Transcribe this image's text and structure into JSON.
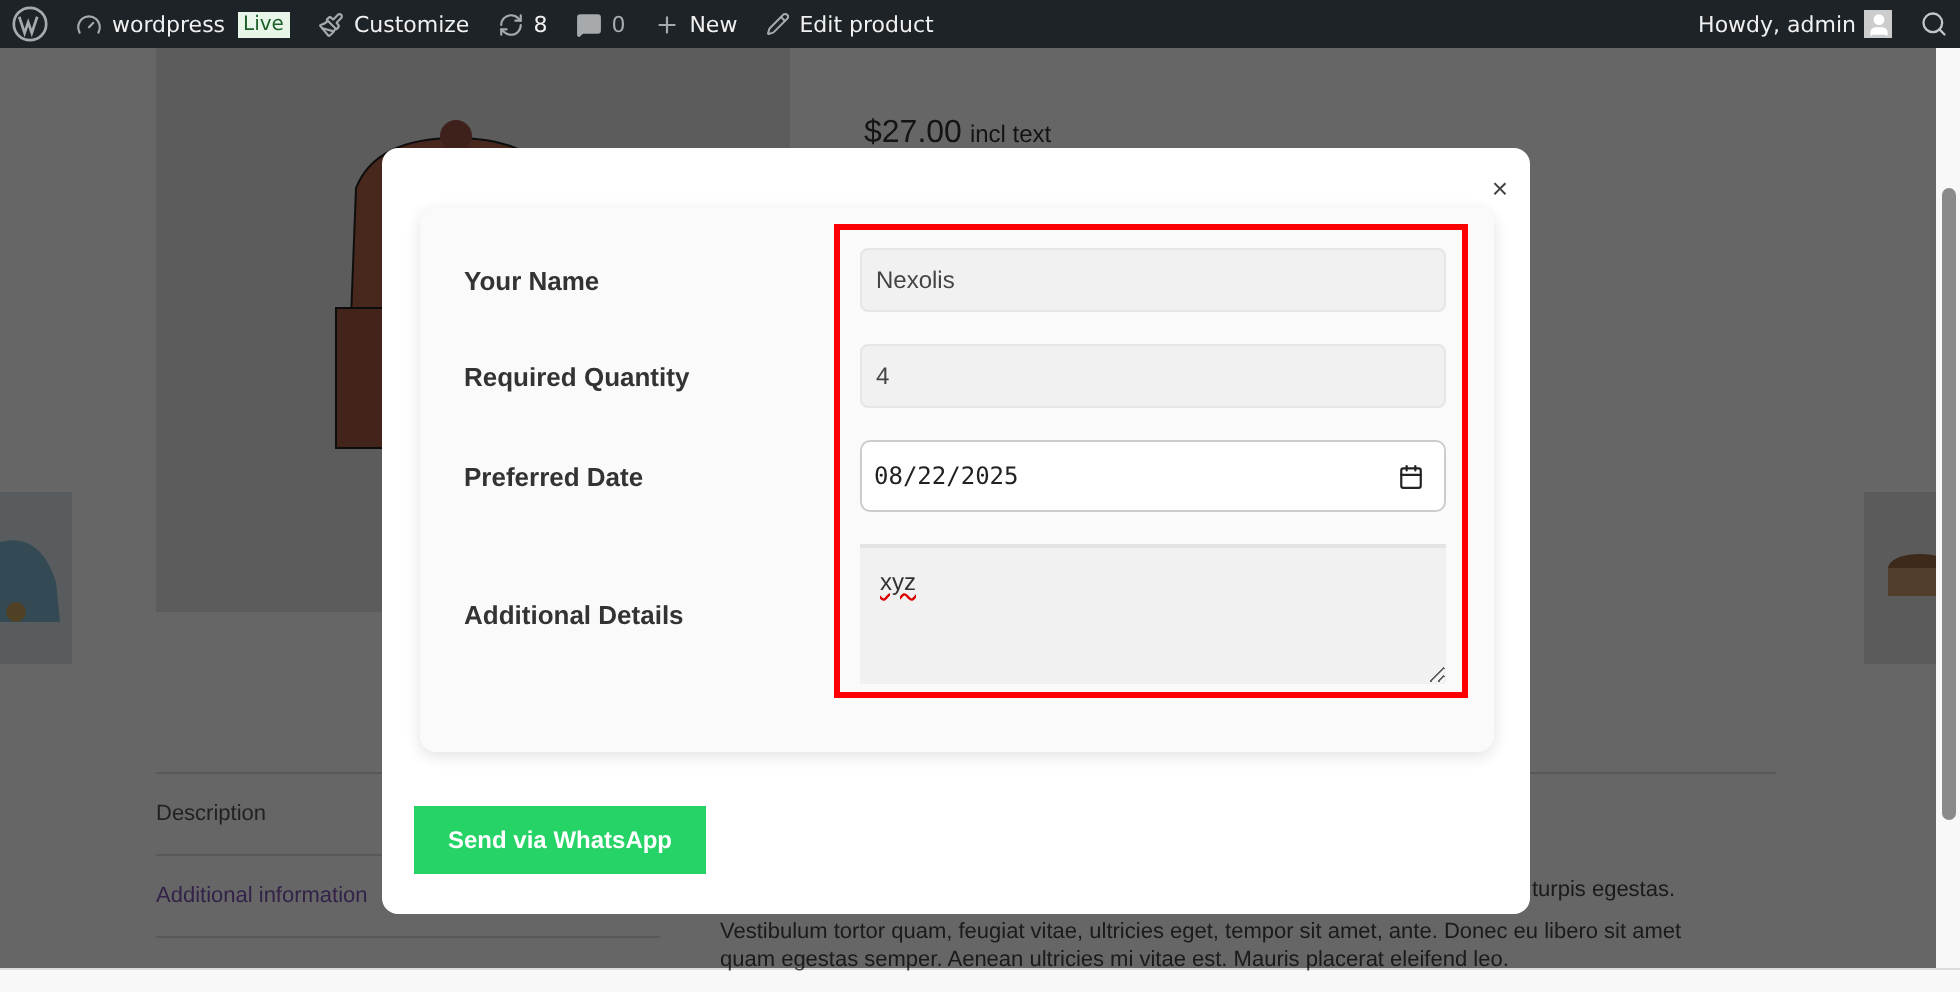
{
  "admin_bar": {
    "site": "wordpress",
    "live_badge": "Live",
    "customize": "Customize",
    "updates": "8",
    "comments": "0",
    "new": "New",
    "edit": "Edit product",
    "greeting": "Howdy, admin"
  },
  "product": {
    "price": "$27.00",
    "price_suffix": "incl text"
  },
  "tabs": [
    {
      "label": "Description",
      "selected": true
    },
    {
      "label": "Additional information",
      "selected": false
    }
  ],
  "description": [
    "turpis egestas.",
    "Vestibulum tortor quam, feugiat vitae, ultricies eget, tempor sit amet, ante. Donec eu libero sit amet",
    "quam egestas semper. Aenean ultricies mi vitae est. Mauris placerat eleifend leo."
  ],
  "modal": {
    "close": "×",
    "submit": "Send via WhatsApp",
    "fields": [
      {
        "kind": "text",
        "label": "Your Name",
        "value": "Nexolis"
      },
      {
        "kind": "text",
        "label": "Required Quantity",
        "value": "4"
      },
      {
        "kind": "date",
        "label": "Preferred Date",
        "value": "08/22/2025"
      },
      {
        "kind": "textarea",
        "label": "Additional Details",
        "value": "xyz"
      }
    ]
  }
}
